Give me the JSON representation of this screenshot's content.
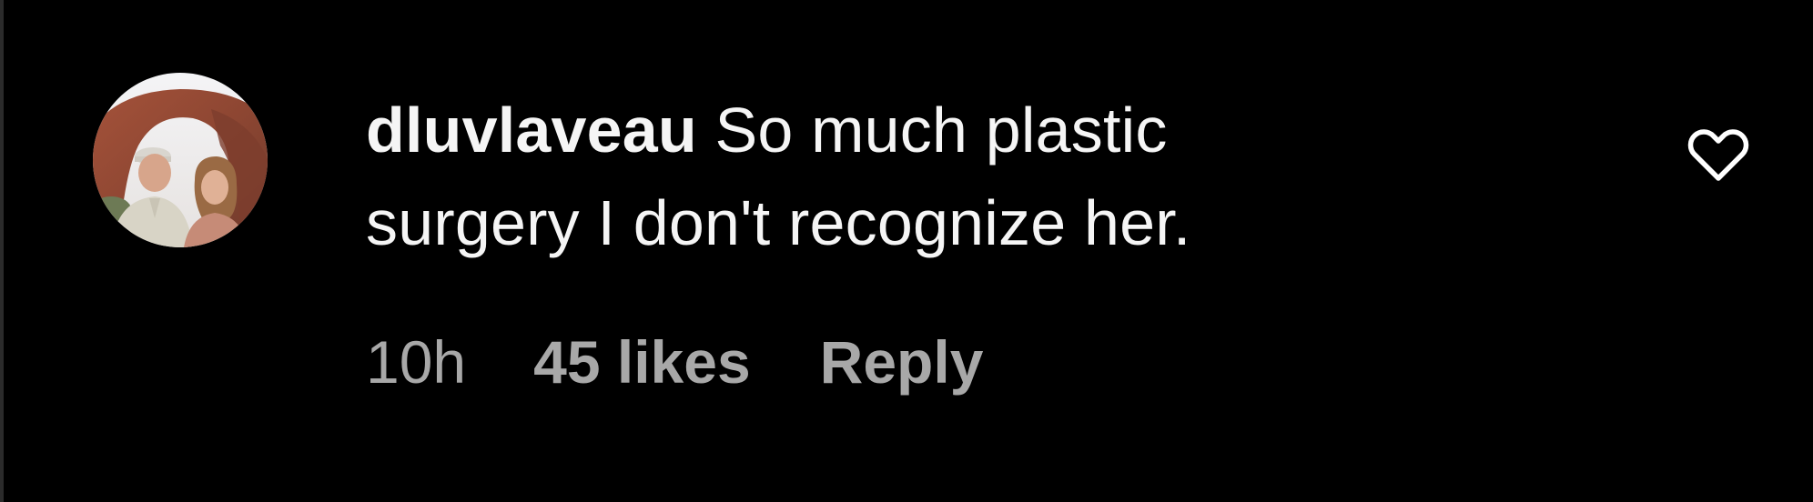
{
  "comment": {
    "avatar_alt": "avatar",
    "username": "dluvlaveau",
    "text_line1": "So much plastic",
    "text_line2": "surgery I don't recognize her.",
    "time": "10h",
    "likes": "45 likes",
    "reply_label": "Reply",
    "like_icon": "heart-outline-icon"
  },
  "colors": {
    "background": "#000000",
    "primary_text": "#f5f5f5",
    "secondary_text": "#a8a8a8"
  }
}
